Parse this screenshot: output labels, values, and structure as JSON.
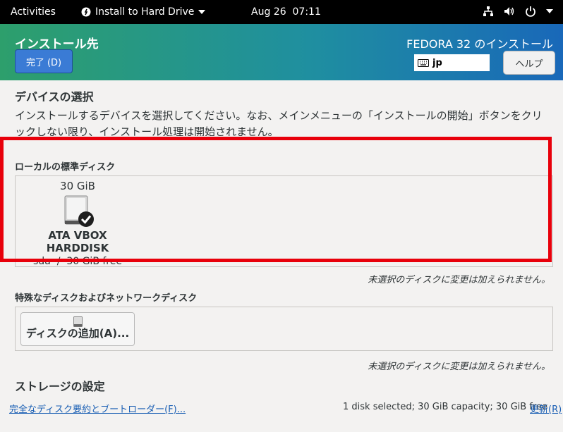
{
  "topbar": {
    "activities": "Activities",
    "app_menu": "Install to Hard Drive",
    "date": "Aug 26",
    "time": "07:11"
  },
  "header": {
    "title": "インストール先",
    "done_button": "完了 (D)",
    "product": "FEDORA 32 のインストール",
    "keyboard_layout": "jp",
    "help_button": "ヘルプ"
  },
  "device_selection": {
    "heading": "デバイスの選択",
    "description": "インストールするデバイスを選択してください。なお、メインメニューの「インストールの開始」ボタンをクリックしない限り、インストール処理は開始されません。"
  },
  "local_disks": {
    "label": "ローカルの標準ディスク",
    "disk": {
      "size": "30 GiB",
      "name": "ATA VBOX HARDDISK",
      "device": "sda",
      "separator": "/",
      "free": "30 GiB free"
    },
    "note": "未選択のディスクに変更は加えられません。"
  },
  "specialized_disks": {
    "label": "特殊なディスクおよびネットワークディスク",
    "add_button": "ディスクの追加(A)...",
    "note": "未選択のディスクに変更は加えられません。"
  },
  "storage": {
    "heading": "ストレージの設定",
    "summary_link": "完全なディスク要約とブートローダー(F)...",
    "summary": "1 disk selected; 30 GiB capacity; 30 GiB free",
    "refresh_link": "更新(R)"
  },
  "colors": {
    "highlight_box": "#e8000b",
    "accent": "#3a7bd5",
    "link": "#1a5fb4"
  }
}
